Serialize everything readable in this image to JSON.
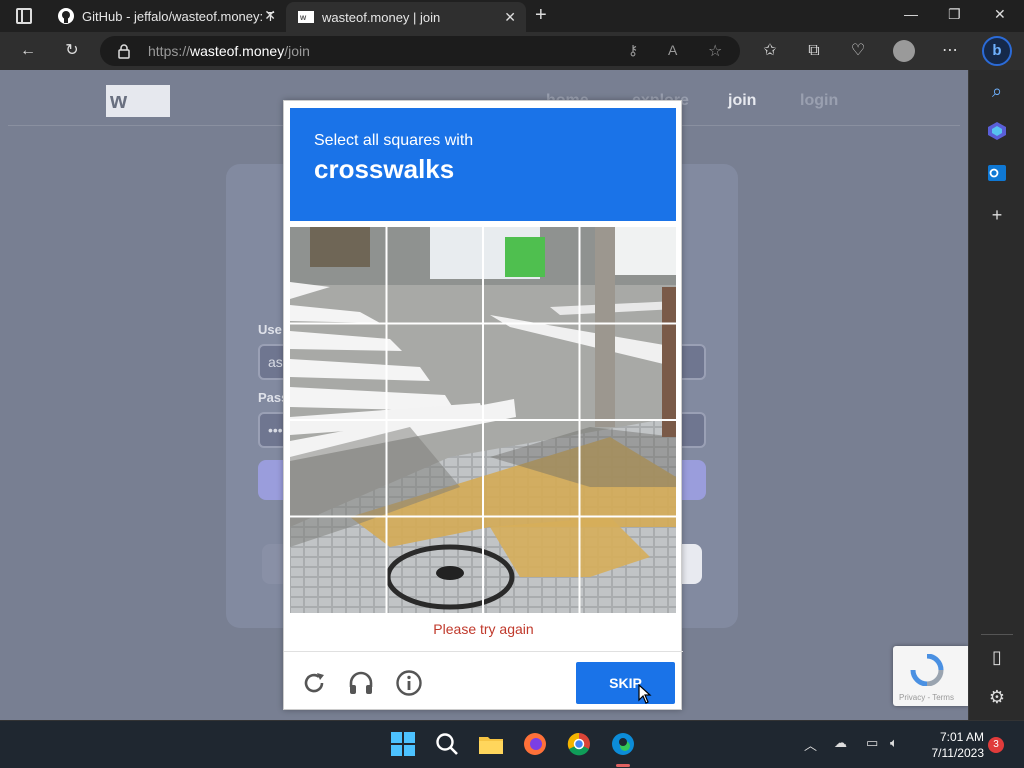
{
  "browser": {
    "tabs": [
      {
        "title": "GitHub - jeffalo/wasteof.money: T"
      },
      {
        "title": "wasteof.money | join"
      }
    ],
    "url": {
      "scheme": "https://",
      "host": "wasteof.money",
      "path": "/join"
    }
  },
  "site": {
    "logo": "w",
    "nav": {
      "home": "home",
      "explore": "explore",
      "join": "join",
      "login": "login"
    },
    "form": {
      "username_label": "Use",
      "username_value": "asa",
      "password_label": "Pass",
      "password_value": "•••"
    }
  },
  "captcha": {
    "prompt_line1": "Select all squares with",
    "prompt_line2": "crosswalks",
    "error": "Please try again",
    "skip_label": "SKIP",
    "badge_terms": "Privacy - Terms"
  },
  "taskbar": {
    "time": "7:01 AM",
    "date": "7/11/2023",
    "notification_count": "3"
  },
  "colors": {
    "captcha_blue": "#1a73e8",
    "error_red": "#c0392b",
    "page_overlay": "#787f92"
  }
}
